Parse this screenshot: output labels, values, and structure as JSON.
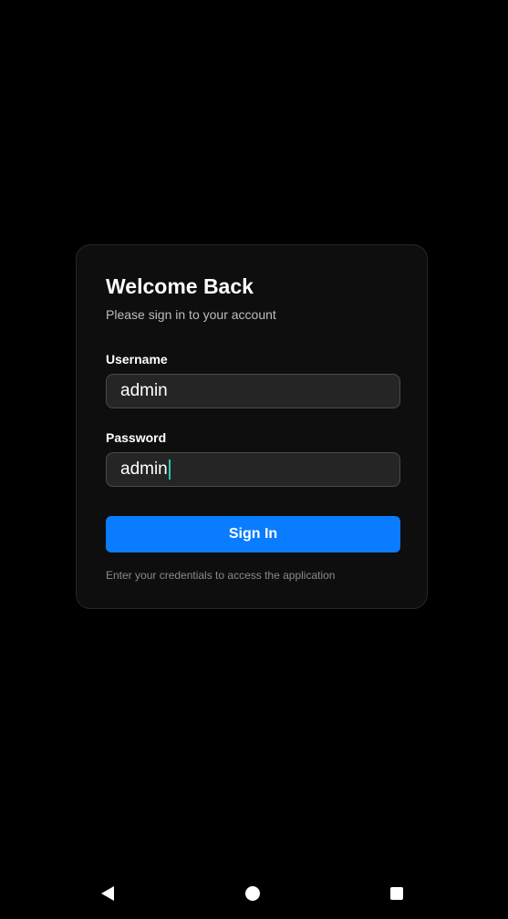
{
  "login": {
    "title": "Welcome Back",
    "subtitle": "Please sign in to your account",
    "username_label": "Username",
    "username_value": "admin",
    "password_label": "Password",
    "password_value": "admin",
    "sign_in_label": "Sign In",
    "helper_text": "Enter your credentials to access the application"
  },
  "navbar": {
    "back_icon": "back-triangle-icon",
    "home_icon": "home-circle-icon",
    "recents_icon": "recents-square-icon"
  },
  "colors": {
    "background": "#000000",
    "card": "#0e0e0e",
    "accent": "#0a7cff",
    "caret": "#2ec4b6"
  }
}
